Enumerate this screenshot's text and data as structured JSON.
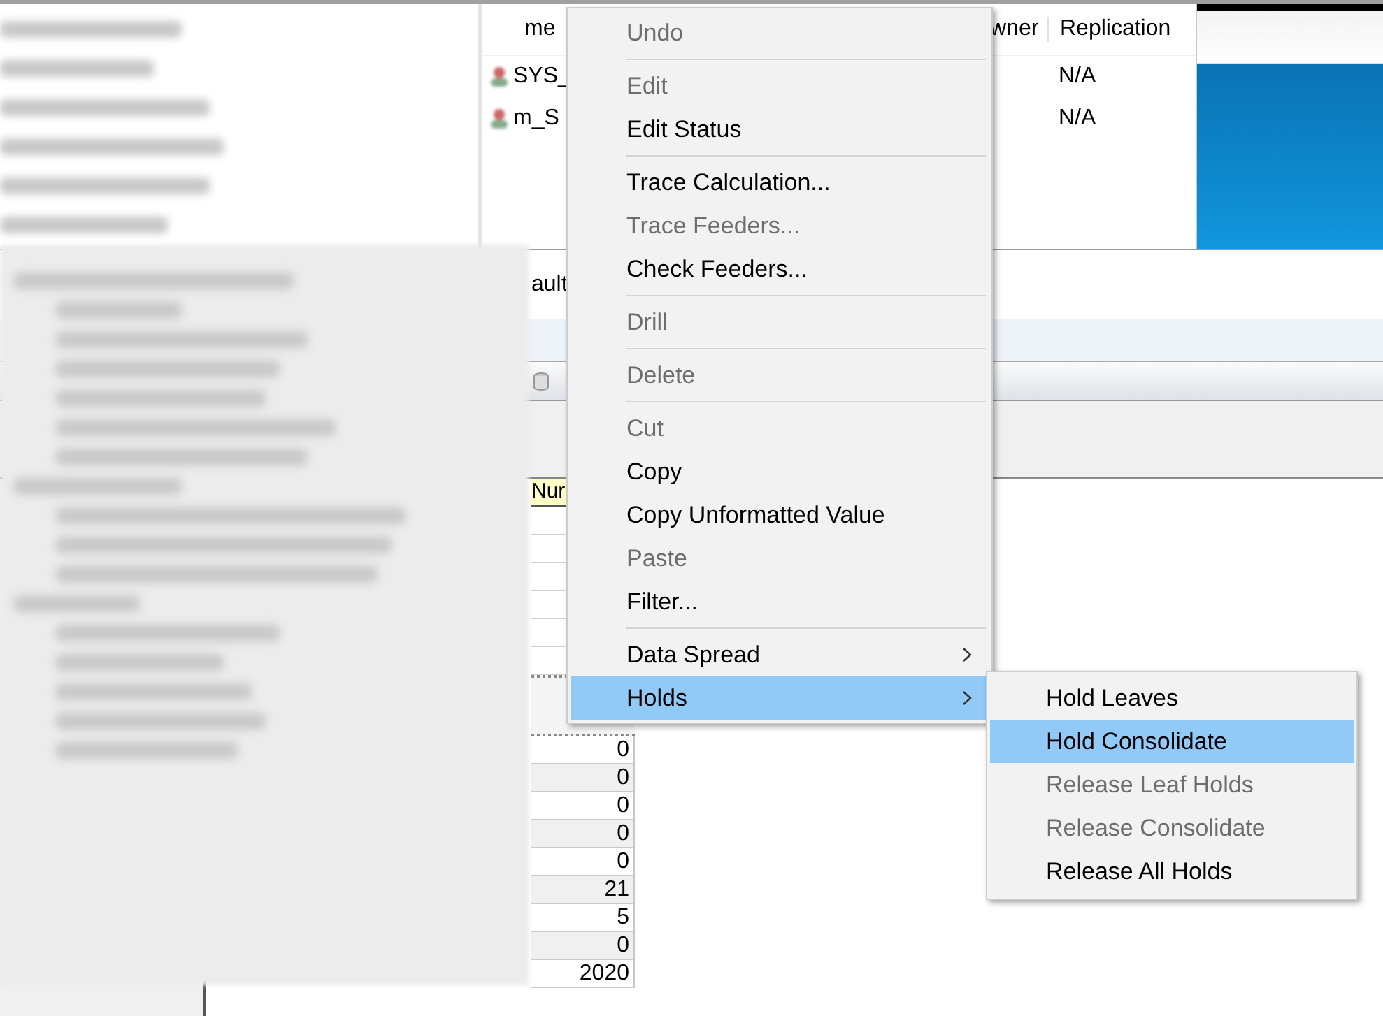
{
  "background_window": {
    "columns": [
      "me",
      "wner",
      "Replication"
    ],
    "rows": [
      {
        "name": "SYS_",
        "replication": "N/A"
      },
      {
        "name": "m_S",
        "replication": "N/A"
      }
    ]
  },
  "viewer_window": {
    "title": "ault",
    "column_header": "Nur",
    "values": [
      "0",
      "0",
      "0",
      "0",
      "0",
      "21",
      "5",
      "0",
      "2020"
    ]
  },
  "context_menu": {
    "items": [
      {
        "kind": "item",
        "label": "Undo",
        "disabled": true,
        "selected": false,
        "submenu": false
      },
      {
        "kind": "separator"
      },
      {
        "kind": "item",
        "label": "Edit",
        "disabled": true,
        "selected": false,
        "submenu": false
      },
      {
        "kind": "item",
        "label": "Edit Status",
        "disabled": false,
        "selected": false,
        "submenu": false
      },
      {
        "kind": "separator"
      },
      {
        "kind": "item",
        "label": "Trace Calculation...",
        "disabled": false,
        "selected": false,
        "submenu": false
      },
      {
        "kind": "item",
        "label": "Trace Feeders...",
        "disabled": true,
        "selected": false,
        "submenu": false
      },
      {
        "kind": "item",
        "label": "Check Feeders...",
        "disabled": false,
        "selected": false,
        "submenu": false
      },
      {
        "kind": "separator"
      },
      {
        "kind": "item",
        "label": "Drill",
        "disabled": true,
        "selected": false,
        "submenu": false
      },
      {
        "kind": "separator"
      },
      {
        "kind": "item",
        "label": "Delete",
        "disabled": true,
        "selected": false,
        "submenu": false
      },
      {
        "kind": "separator"
      },
      {
        "kind": "item",
        "label": "Cut",
        "disabled": true,
        "selected": false,
        "submenu": false
      },
      {
        "kind": "item",
        "label": "Copy",
        "disabled": false,
        "selected": false,
        "submenu": false
      },
      {
        "kind": "item",
        "label": "Copy Unformatted Value",
        "disabled": false,
        "selected": false,
        "submenu": false
      },
      {
        "kind": "item",
        "label": "Paste",
        "disabled": true,
        "selected": false,
        "submenu": false
      },
      {
        "kind": "item",
        "label": "Filter...",
        "disabled": false,
        "selected": false,
        "submenu": false
      },
      {
        "kind": "separator"
      },
      {
        "kind": "item",
        "label": "Data Spread",
        "disabled": false,
        "selected": false,
        "submenu": true
      },
      {
        "kind": "item",
        "label": "Holds",
        "disabled": false,
        "selected": true,
        "submenu": true
      }
    ]
  },
  "submenu": {
    "items": [
      {
        "label": "Hold Leaves",
        "disabled": false,
        "selected": false
      },
      {
        "label": "Hold Consolidate",
        "disabled": false,
        "selected": true
      },
      {
        "label": "Release Leaf Holds",
        "disabled": true,
        "selected": false
      },
      {
        "label": "Release Consolidate",
        "disabled": true,
        "selected": false
      },
      {
        "label": "Release All Holds",
        "disabled": false,
        "selected": false
      }
    ]
  }
}
